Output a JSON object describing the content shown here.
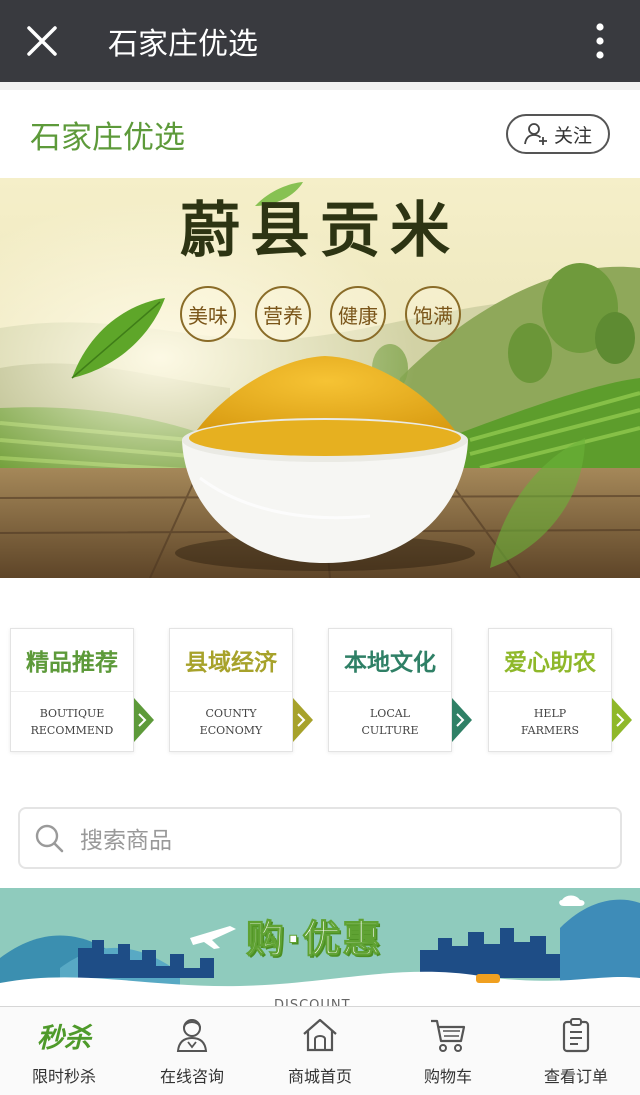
{
  "topbar": {
    "title": "石家庄优选",
    "close_icon": "close-icon",
    "more_icon": "more-vertical-icon"
  },
  "shop": {
    "name": "石家庄优选",
    "follow_label": "关注",
    "follow_icon": "add-user-icon"
  },
  "banner": {
    "title": "蔚县贡米",
    "badges": [
      "美味",
      "营养",
      "健康",
      "饱满"
    ]
  },
  "categories": [
    {
      "title": "精品推荐",
      "en_line1": "BOUTIQUE",
      "en_line2": "RECOMMEND",
      "color": "#5d9a3a"
    },
    {
      "title": "县域经济",
      "en_line1": "COUNTY",
      "en_line2": "ECONOMY",
      "color": "#a7a22b"
    },
    {
      "title": "本地文化",
      "en_line1": "LOCAL",
      "en_line2": "CULTURE",
      "color": "#2f8066"
    },
    {
      "title": "爱心助农",
      "en_line1": "HELP",
      "en_line2": "FARMERS",
      "color": "#8fb82a"
    }
  ],
  "search": {
    "placeholder": "搜索商品",
    "icon": "search-icon"
  },
  "promo": {
    "title": "购·优惠",
    "subtitle": "DISCOUNT"
  },
  "tabbar": [
    {
      "label": "限时秒杀",
      "icon_text": "秒杀",
      "icon": "flash-sale-icon"
    },
    {
      "label": "在线咨询",
      "icon": "customer-service-icon"
    },
    {
      "label": "商城首页",
      "icon": "home-icon"
    },
    {
      "label": "购物车",
      "icon": "cart-icon"
    },
    {
      "label": "查看订单",
      "icon": "order-list-icon"
    }
  ],
  "colors": {
    "topbar_bg": "#393a3f",
    "brand_green": "#5d9a3a",
    "promo_teal": "#8fcbbd"
  }
}
